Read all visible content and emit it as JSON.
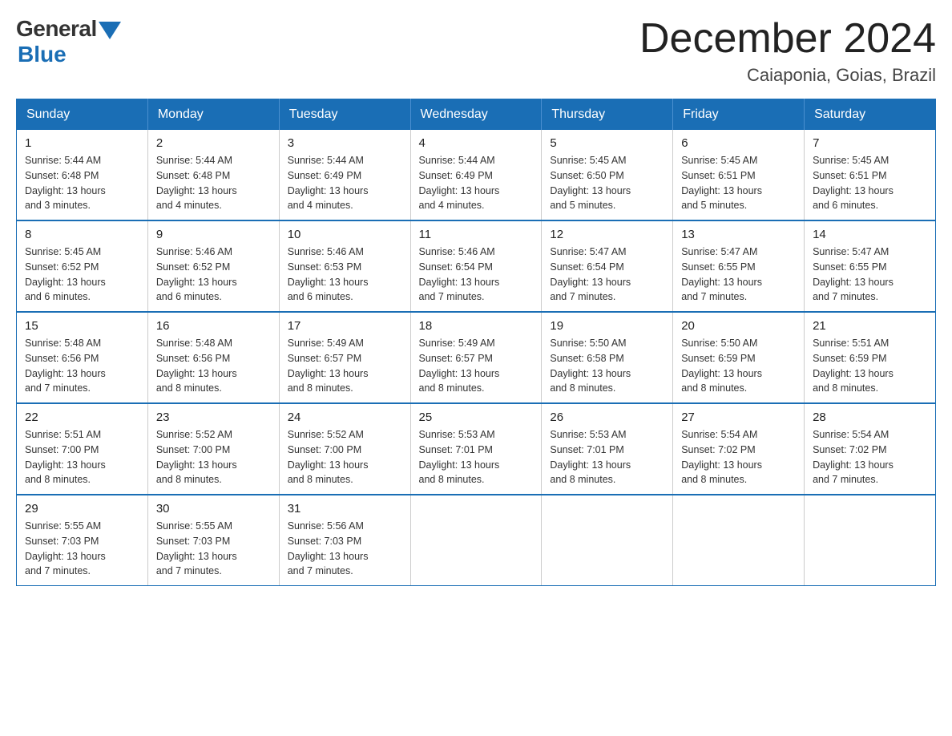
{
  "logo": {
    "general": "General",
    "blue": "Blue"
  },
  "title": {
    "month": "December 2024",
    "location": "Caiaponia, Goias, Brazil"
  },
  "headers": [
    "Sunday",
    "Monday",
    "Tuesday",
    "Wednesday",
    "Thursday",
    "Friday",
    "Saturday"
  ],
  "weeks": [
    [
      {
        "day": "1",
        "sunrise": "5:44 AM",
        "sunset": "6:48 PM",
        "daylight": "13 hours and 3 minutes."
      },
      {
        "day": "2",
        "sunrise": "5:44 AM",
        "sunset": "6:48 PM",
        "daylight": "13 hours and 4 minutes."
      },
      {
        "day": "3",
        "sunrise": "5:44 AM",
        "sunset": "6:49 PM",
        "daylight": "13 hours and 4 minutes."
      },
      {
        "day": "4",
        "sunrise": "5:44 AM",
        "sunset": "6:49 PM",
        "daylight": "13 hours and 4 minutes."
      },
      {
        "day": "5",
        "sunrise": "5:45 AM",
        "sunset": "6:50 PM",
        "daylight": "13 hours and 5 minutes."
      },
      {
        "day": "6",
        "sunrise": "5:45 AM",
        "sunset": "6:51 PM",
        "daylight": "13 hours and 5 minutes."
      },
      {
        "day": "7",
        "sunrise": "5:45 AM",
        "sunset": "6:51 PM",
        "daylight": "13 hours and 6 minutes."
      }
    ],
    [
      {
        "day": "8",
        "sunrise": "5:45 AM",
        "sunset": "6:52 PM",
        "daylight": "13 hours and 6 minutes."
      },
      {
        "day": "9",
        "sunrise": "5:46 AM",
        "sunset": "6:52 PM",
        "daylight": "13 hours and 6 minutes."
      },
      {
        "day": "10",
        "sunrise": "5:46 AM",
        "sunset": "6:53 PM",
        "daylight": "13 hours and 6 minutes."
      },
      {
        "day": "11",
        "sunrise": "5:46 AM",
        "sunset": "6:54 PM",
        "daylight": "13 hours and 7 minutes."
      },
      {
        "day": "12",
        "sunrise": "5:47 AM",
        "sunset": "6:54 PM",
        "daylight": "13 hours and 7 minutes."
      },
      {
        "day": "13",
        "sunrise": "5:47 AM",
        "sunset": "6:55 PM",
        "daylight": "13 hours and 7 minutes."
      },
      {
        "day": "14",
        "sunrise": "5:47 AM",
        "sunset": "6:55 PM",
        "daylight": "13 hours and 7 minutes."
      }
    ],
    [
      {
        "day": "15",
        "sunrise": "5:48 AM",
        "sunset": "6:56 PM",
        "daylight": "13 hours and 7 minutes."
      },
      {
        "day": "16",
        "sunrise": "5:48 AM",
        "sunset": "6:56 PM",
        "daylight": "13 hours and 8 minutes."
      },
      {
        "day": "17",
        "sunrise": "5:49 AM",
        "sunset": "6:57 PM",
        "daylight": "13 hours and 8 minutes."
      },
      {
        "day": "18",
        "sunrise": "5:49 AM",
        "sunset": "6:57 PM",
        "daylight": "13 hours and 8 minutes."
      },
      {
        "day": "19",
        "sunrise": "5:50 AM",
        "sunset": "6:58 PM",
        "daylight": "13 hours and 8 minutes."
      },
      {
        "day": "20",
        "sunrise": "5:50 AM",
        "sunset": "6:59 PM",
        "daylight": "13 hours and 8 minutes."
      },
      {
        "day": "21",
        "sunrise": "5:51 AM",
        "sunset": "6:59 PM",
        "daylight": "13 hours and 8 minutes."
      }
    ],
    [
      {
        "day": "22",
        "sunrise": "5:51 AM",
        "sunset": "7:00 PM",
        "daylight": "13 hours and 8 minutes."
      },
      {
        "day": "23",
        "sunrise": "5:52 AM",
        "sunset": "7:00 PM",
        "daylight": "13 hours and 8 minutes."
      },
      {
        "day": "24",
        "sunrise": "5:52 AM",
        "sunset": "7:00 PM",
        "daylight": "13 hours and 8 minutes."
      },
      {
        "day": "25",
        "sunrise": "5:53 AM",
        "sunset": "7:01 PM",
        "daylight": "13 hours and 8 minutes."
      },
      {
        "day": "26",
        "sunrise": "5:53 AM",
        "sunset": "7:01 PM",
        "daylight": "13 hours and 8 minutes."
      },
      {
        "day": "27",
        "sunrise": "5:54 AM",
        "sunset": "7:02 PM",
        "daylight": "13 hours and 8 minutes."
      },
      {
        "day": "28",
        "sunrise": "5:54 AM",
        "sunset": "7:02 PM",
        "daylight": "13 hours and 7 minutes."
      }
    ],
    [
      {
        "day": "29",
        "sunrise": "5:55 AM",
        "sunset": "7:03 PM",
        "daylight": "13 hours and 7 minutes."
      },
      {
        "day": "30",
        "sunrise": "5:55 AM",
        "sunset": "7:03 PM",
        "daylight": "13 hours and 7 minutes."
      },
      {
        "day": "31",
        "sunrise": "5:56 AM",
        "sunset": "7:03 PM",
        "daylight": "13 hours and 7 minutes."
      },
      null,
      null,
      null,
      null
    ]
  ],
  "labels": {
    "sunrise": "Sunrise:",
    "sunset": "Sunset:",
    "daylight": "Daylight:"
  }
}
